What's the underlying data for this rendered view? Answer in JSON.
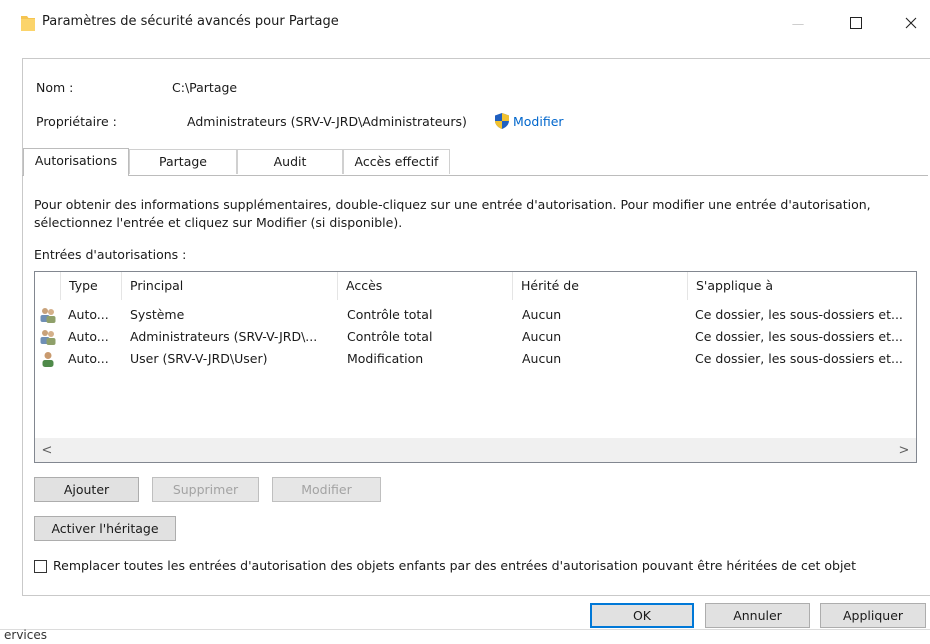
{
  "window": {
    "title": "Paramètres de sécurité avancés pour Partage",
    "controls": {
      "minimize": "—",
      "maximize": "☐",
      "close": "✕"
    }
  },
  "info": {
    "name_label": "Nom :",
    "name_value": "C:\\Partage",
    "owner_label": "Propriétaire :",
    "owner_value": "Administrateurs (SRV-V-JRD\\Administrateurs)",
    "owner_change": "Modifier"
  },
  "tabs": [
    {
      "label": "Autorisations",
      "active": true
    },
    {
      "label": "Partage",
      "active": false
    },
    {
      "label": "Audit",
      "active": false
    },
    {
      "label": "Accès effectif",
      "active": false
    }
  ],
  "description": {
    "line1": "Pour obtenir des informations supplémentaires, double-cliquez sur une entrée d'autorisation. Pour modifier une entrée d'autorisation,",
    "line2": "sélectionnez l'entrée et cliquez sur Modifier (si disponible)."
  },
  "entries_label": "Entrées d'autorisations :",
  "table": {
    "headers": [
      "Type",
      "Principal",
      "Accès",
      "Hérité de",
      "S'applique à"
    ],
    "rows": [
      {
        "icon": "group-users-icon",
        "type": "Auto...",
        "principal": "Système",
        "access": "Contrôle total",
        "inherited": "Aucun",
        "applies": "Ce dossier, les sous-dossiers et..."
      },
      {
        "icon": "group-users-icon",
        "type": "Auto...",
        "principal": "Administrateurs (SRV-V-JRD\\...",
        "access": "Contrôle total",
        "inherited": "Aucun",
        "applies": "Ce dossier, les sous-dossiers et..."
      },
      {
        "icon": "single-user-icon",
        "type": "Auto...",
        "principal": "User (SRV-V-JRD\\User)",
        "access": "Modification",
        "inherited": "Aucun",
        "applies": "Ce dossier, les sous-dossiers et..."
      }
    ],
    "scroll_left": "<",
    "scroll_right": ">"
  },
  "actions": {
    "add": "Ajouter",
    "remove": "Supprimer",
    "edit": "Modifier",
    "enable_inheritance": "Activer l'héritage"
  },
  "replace_checkbox": {
    "label": "Remplacer toutes les entrées d'autorisation des objets enfants par des entrées d'autorisation pouvant être héritées de cet objet",
    "checked": false
  },
  "footer": {
    "ok": "OK",
    "cancel": "Annuler",
    "apply": "Appliquer"
  },
  "background_text": "ervices",
  "colors": {
    "accent": "#0078d7",
    "link": "#0066cc",
    "folder": "#f5c451"
  }
}
